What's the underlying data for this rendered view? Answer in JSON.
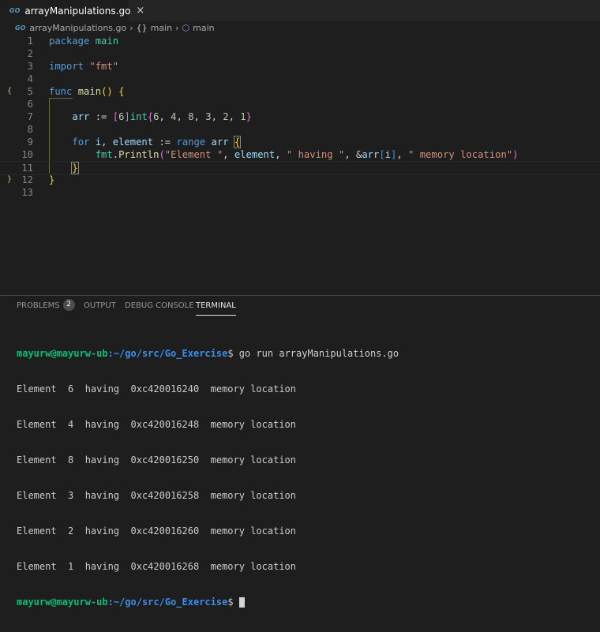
{
  "tab": {
    "filename": "arrayManipulations.go",
    "icon": "go-file-icon",
    "close": "×"
  },
  "breadcrumb": {
    "file": "arrayManipulations.go",
    "package": "main",
    "function": "main"
  },
  "editor": {
    "line_numbers": [
      "1",
      "2",
      "3",
      "4",
      "5",
      "6",
      "7",
      "8",
      "9",
      "10",
      "11",
      "12",
      "13"
    ],
    "tokens": {
      "package": "package",
      "main": "main",
      "import": "import",
      "fmt": "\"fmt\"",
      "func": "func",
      "main_fn": "main",
      "paren_open": "(",
      "paren_close": ")",
      "brace_open": "{",
      "arr": "arr",
      "assign": " := ",
      "arr_bracket_open": "[",
      "six": "6",
      "arr_bracket_close": "]",
      "int": "int",
      "lit_open": "{",
      "lit_vals": [
        "6",
        "4",
        "8",
        "3",
        "2",
        "1"
      ],
      "lit_close": "}",
      "for": "for",
      "i": "i",
      "element": "element",
      "range": "range",
      "arr2": "arr",
      "for_brace": "{",
      "fmt_pkg": "fmt",
      "println": "Println",
      "call_open": "(",
      "str1": "\"Element \"",
      "element2": "element",
      "str2": "\" having \"",
      "amp": "&",
      "arr3": "arr",
      "idx_open": "[",
      "i2": "i",
      "idx_close": "]",
      "str3": "\" memory location\"",
      "call_close": ")",
      "for_close": "}",
      "func_close": "}"
    }
  },
  "panel": {
    "tabs": [
      "PROBLEMS",
      "OUTPUT",
      "DEBUG CONSOLE",
      "TERMINAL"
    ],
    "problems_count": "2",
    "active_tab": "TERMINAL"
  },
  "terminal": {
    "user_host": "mayurw@mayurw-ub",
    "path": ":~/go/src/Go_Exercise",
    "prompt_end": "$",
    "command": " go run arrayManipulations.go",
    "output": [
      "Element  6  having  0xc420016240  memory location",
      "Element  4  having  0xc420016248  memory location",
      "Element  8  having  0xc420016250  memory location",
      "Element  3  having  0xc420016258  memory location",
      "Element  2  having  0xc420016260  memory location",
      "Element  1  having  0xc420016268  memory location"
    ]
  }
}
